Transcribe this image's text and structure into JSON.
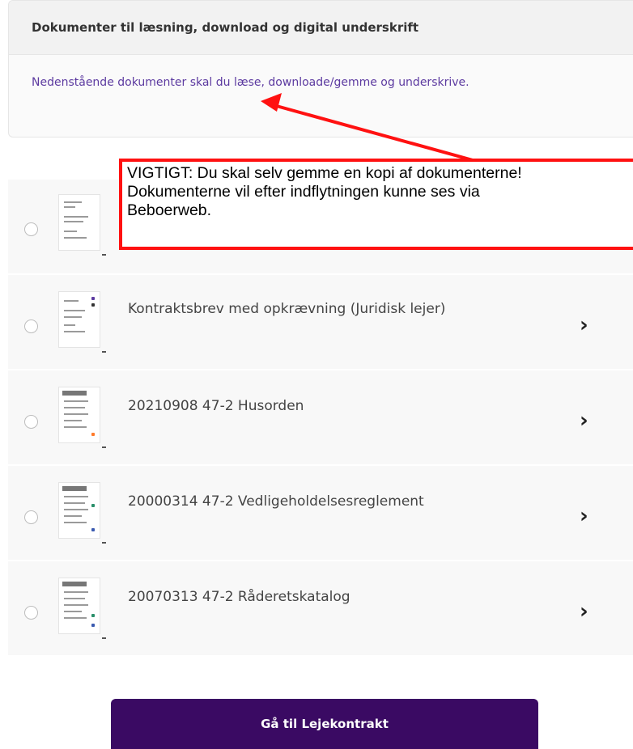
{
  "info": {
    "heading": "Dokumenter til læsning, download og digital underskrift",
    "text": "Nedenstående dokumenter skal du læse, downloade/gemme og underskrive."
  },
  "annotation": {
    "line1": "VIGTIGT: Du skal selv gemme en kopi af dokumenterne!",
    "line2": "Dokumenterne vil efter indflytningen kunne ses via",
    "line3": "Beboerweb.",
    "color": "#ff1111"
  },
  "documents": [
    {
      "title": ""
    },
    {
      "title": "Kontraktsbrev med opkrævning (Juridisk lejer)"
    },
    {
      "title": "20210908 47-2 Husorden"
    },
    {
      "title": "20000314 47-2 Vedligeholdelsesreglement"
    },
    {
      "title": "20070313 47-2 Råderetskatalog"
    }
  ],
  "icons": {
    "chevron": "chevron-right-icon",
    "document": "document-thumbnail-icon"
  },
  "cta": {
    "label": "Gå til Lejekontrakt",
    "color": "#3a0a63"
  },
  "link_color": "#5c3aa0"
}
